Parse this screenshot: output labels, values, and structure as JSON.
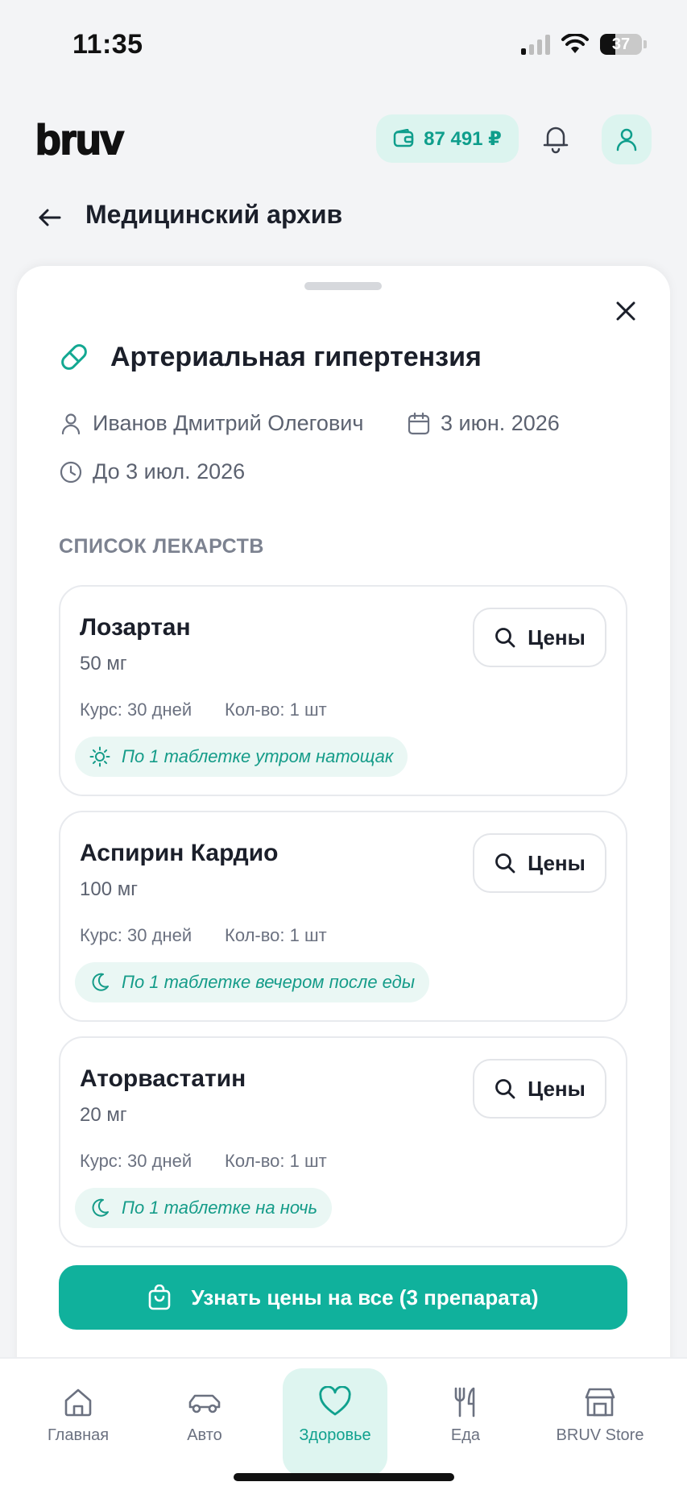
{
  "status_bar": {
    "time": "11:35",
    "battery_level": "37",
    "battery_fraction": 0.37
  },
  "header": {
    "logo": "bruv",
    "balance": "87 491 ₽",
    "icons": [
      "wallet-icon",
      "bell-icon",
      "user-icon"
    ]
  },
  "page": {
    "title": "Медицинский архив"
  },
  "sheet": {
    "title": "Артериальная гипертензия",
    "patient": "Иванов Дмитрий Олегович",
    "date": "3 июн. 2026",
    "until": "До 3 июл. 2026",
    "section_title": "СПИСОК ЛЕКАРСТВ",
    "medications": [
      {
        "name": "Лозартан",
        "dose": "50 мг",
        "course": "Курс: 30 дней",
        "quantity": "Кол-во: 1 шт",
        "instruction": "По 1 таблетке утром натощак",
        "instruction_icon": "sun-icon",
        "prices_label": "Цены"
      },
      {
        "name": "Аспирин Кардио",
        "dose": "100 мг",
        "course": "Курс: 30 дней",
        "quantity": "Кол-во: 1 шт",
        "instruction": "По 1 таблетке вечером после еды",
        "instruction_icon": "moon-icon",
        "prices_label": "Цены"
      },
      {
        "name": "Аторвастатин",
        "dose": "20 мг",
        "course": "Курс: 30 дней",
        "quantity": "Кол-во: 1 шт",
        "instruction": "По 1 таблетке на ночь",
        "instruction_icon": "moon-icon",
        "prices_label": "Цены"
      }
    ],
    "cta_label": "Узнать цены на все (3 препарата)"
  },
  "bottom_nav": {
    "items": [
      {
        "label": "Главная",
        "icon": "home-icon"
      },
      {
        "label": "Авто",
        "icon": "car-icon"
      },
      {
        "label": "Здоровье",
        "icon": "heart-icon"
      },
      {
        "label": "Еда",
        "icon": "utensils-icon"
      },
      {
        "label": "BRUV Store",
        "icon": "store-icon"
      }
    ],
    "active": "Здоровье"
  },
  "colors": {
    "accent": "#10b19c",
    "accent_light": "#dcf4ef",
    "text": "#1b1f2a",
    "muted": "#5c6270"
  }
}
